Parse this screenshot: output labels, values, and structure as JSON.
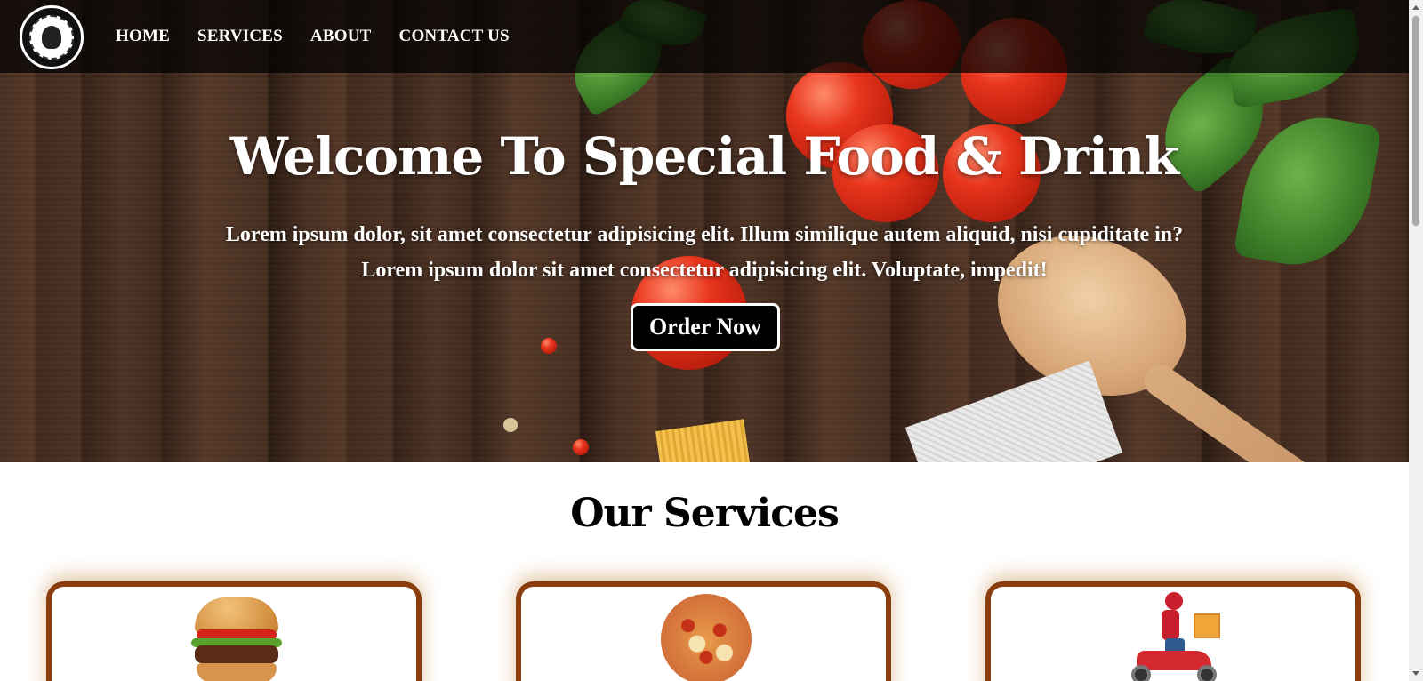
{
  "nav": {
    "logo_icon": "restaurant-logo-icon",
    "links": [
      {
        "label": "HOME"
      },
      {
        "label": "SERVICES"
      },
      {
        "label": "ABOUT"
      },
      {
        "label": "CONTACT US"
      }
    ]
  },
  "hero": {
    "title": "Welcome To Special Food & Drink",
    "subtitle_line1": "Lorem ipsum dolor, sit amet consectetur adipisicing elit. Illum similique autem aliquid, nisi cupiditate in?",
    "subtitle_line2": "Lorem ipsum dolor sit amet consectetur adipisicing elit. Voluptate, impedit!",
    "button_label": "Order Now"
  },
  "services": {
    "title": "Our Services",
    "cards": [
      {
        "image": "burger-image"
      },
      {
        "image": "pizza-image"
      },
      {
        "image": "delivery-scooter-image"
      }
    ]
  },
  "colors": {
    "card_border": "#8b3e0d",
    "card_glow": "#be7828",
    "nav_bg": "#000000",
    "button_bg": "#000000"
  }
}
